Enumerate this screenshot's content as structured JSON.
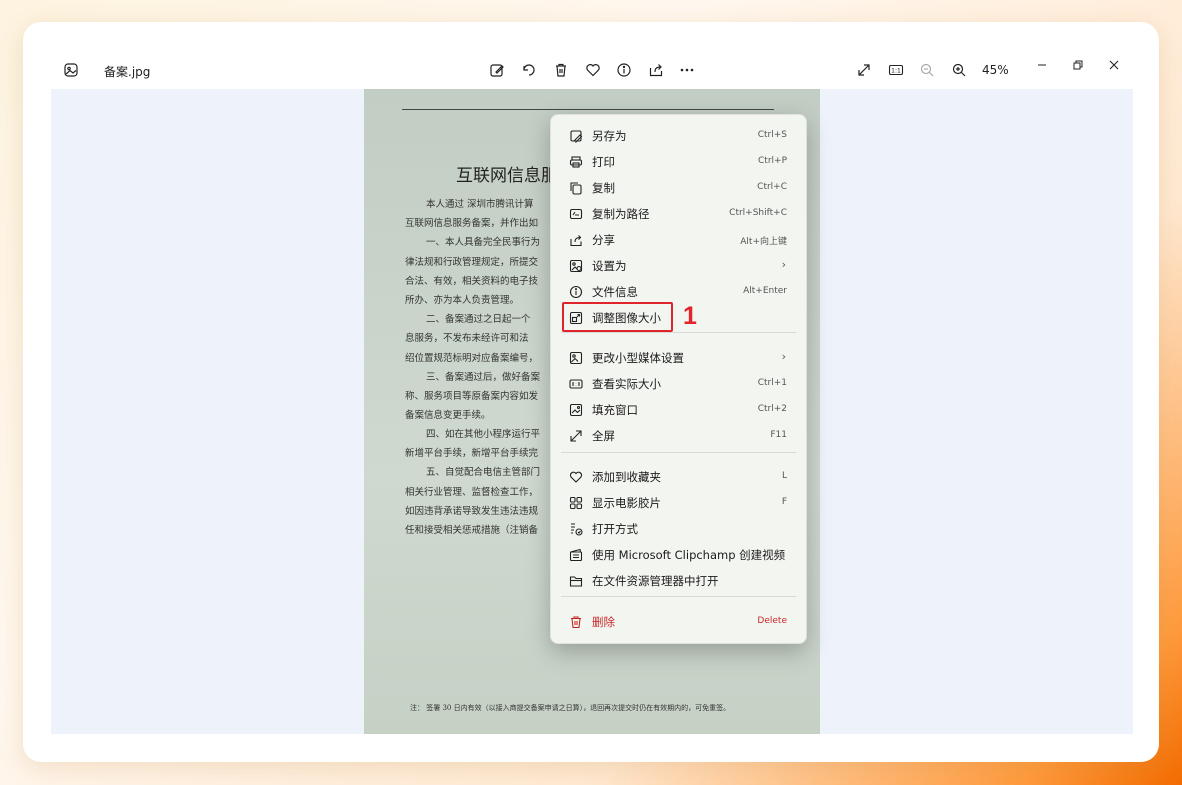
{
  "window": {
    "file_name": "备案.jpg",
    "zoom": "45%"
  },
  "toolbar_icons": [
    "edit-icon",
    "rotate-icon",
    "delete-icon",
    "favorite-icon",
    "info-icon",
    "share-icon",
    "more-icon"
  ],
  "document": {
    "title": "互联网信息服",
    "lines": [
      "本人通过  深圳市腾讯计算",
      "互联网信息服务备案，并作出如",
      "一、本人具备完全民事行为",
      "律法规和行政管理规定，所提交",
      "合法、有效，相关资料的电子技",
      "所办、亦为本人负责管理。",
      "二、备案通过之日起一个",
      "息服务，不发布未经许可和法",
      "绍位置规范标明对应备案编号，",
      "三、备案通过后，做好备案",
      "称、服务项目等原备案内容如发",
      "备案信息变更手续。",
      "四、如在其他小程序运行平",
      "新增平台手续，新增平台手续完",
      "五、自觉配合电信主管部门",
      "相关行业管理、监督检查工作，",
      "如因违背承诺导致发生违法违规",
      "任和接受相关惩戒措施（注销备"
    ],
    "note": "注：  签署 30 日内有效（以接入商提交备案申请之日算），退回再次提交时仍在有效期内的，可免重签。"
  },
  "context_menu": {
    "items": [
      {
        "label": "另存为",
        "shortcut": "Ctrl+S",
        "icon": "save-as-icon"
      },
      {
        "label": "打印",
        "shortcut": "Ctrl+P",
        "icon": "print-icon"
      },
      {
        "label": "复制",
        "shortcut": "Ctrl+C",
        "icon": "copy-icon"
      },
      {
        "label": "复制为路径",
        "shortcut": "Ctrl+Shift+C",
        "icon": "copy-path-icon"
      },
      {
        "label": "分享",
        "shortcut": "Alt+向上键",
        "icon": "share-icon"
      },
      {
        "label": "设置为",
        "shortcut": "",
        "icon": "set-as-icon",
        "submenu": true
      },
      {
        "label": "文件信息",
        "shortcut": "Alt+Enter",
        "icon": "info-icon"
      },
      {
        "label": "调整图像大小",
        "shortcut": "",
        "icon": "resize-icon"
      },
      {
        "label": "更改小型媒体设置",
        "shortcut": "",
        "icon": "media-settings-icon",
        "submenu": true
      },
      {
        "label": "查看实际大小",
        "shortcut": "Ctrl+1",
        "icon": "actual-size-icon"
      },
      {
        "label": "填充窗口",
        "shortcut": "Ctrl+2",
        "icon": "fill-window-icon"
      },
      {
        "label": "全屏",
        "shortcut": "F11",
        "icon": "fullscreen-icon"
      },
      {
        "label": "添加到收藏夹",
        "shortcut": "L",
        "icon": "heart-icon"
      },
      {
        "label": "显示电影胶片",
        "shortcut": "F",
        "icon": "filmstrip-icon"
      },
      {
        "label": "打开方式",
        "shortcut": "",
        "icon": "open-with-icon"
      },
      {
        "label": "使用 Microsoft Clipchamp 创建视频",
        "shortcut": "",
        "icon": "clipchamp-icon"
      },
      {
        "label": "在文件资源管理器中打开",
        "shortcut": "",
        "icon": "folder-icon"
      },
      {
        "label": "删除",
        "shortcut": "Delete",
        "icon": "trash-icon"
      }
    ],
    "submenu_arrow": "›"
  },
  "annotation": {
    "step_number": "1",
    "color": "#e0242b"
  },
  "colors": {
    "accent": "#e0242b",
    "menu_bg": "#f3f5f1",
    "viewer_bg": "#eef3fb"
  }
}
